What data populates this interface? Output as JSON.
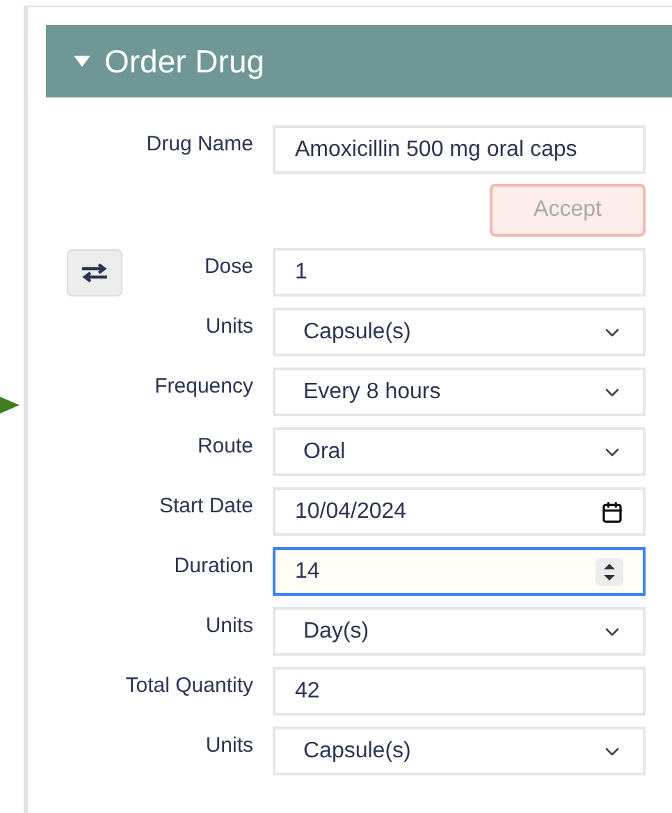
{
  "panel": {
    "title": "Order Drug",
    "expanded": true
  },
  "fields": [
    {
      "kind": "text",
      "label": "Drug Name",
      "value": "Amoxicillin 500 mg oral caps",
      "focused": false,
      "swap": false
    },
    {
      "kind": "button",
      "label": "Accept",
      "disabled": true
    },
    {
      "kind": "text",
      "label": "Dose",
      "value": "1",
      "focused": false,
      "swap": true
    },
    {
      "kind": "select",
      "label": "Units",
      "value": "Capsule(s)",
      "focused": false,
      "swap": false
    },
    {
      "kind": "select",
      "label": "Frequency",
      "value": "Every 8 hours",
      "focused": false,
      "swap": false
    },
    {
      "kind": "select",
      "label": "Route",
      "value": "Oral",
      "focused": false,
      "swap": false
    },
    {
      "kind": "date",
      "label": "Start Date",
      "value": "10/04/2024",
      "focused": false,
      "swap": false
    },
    {
      "kind": "number",
      "label": "Duration",
      "value": "14",
      "focused": true,
      "swap": false
    },
    {
      "kind": "select",
      "label": "Units",
      "value": "Day(s)",
      "focused": false,
      "swap": false
    },
    {
      "kind": "text",
      "label": "Total Quantity",
      "value": "42",
      "focused": false,
      "swap": false
    },
    {
      "kind": "select",
      "label": "Units",
      "value": "Capsule(s)",
      "focused": false,
      "swap": false
    }
  ]
}
